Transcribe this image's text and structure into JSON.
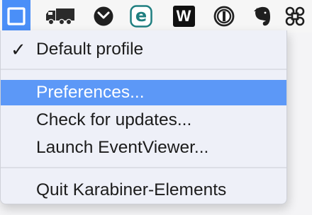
{
  "menubar": {
    "icons": [
      {
        "name": "karabiner-status-icon",
        "state": "active"
      },
      {
        "name": "truck-icon"
      },
      {
        "name": "chevron-circle-icon"
      },
      {
        "name": "eset-icon"
      },
      {
        "name": "word-counter-icon"
      },
      {
        "name": "onepassword-icon"
      },
      {
        "name": "evernote-icon"
      },
      {
        "name": "command-key-icon"
      }
    ],
    "eset_letter": "e",
    "w_letter": "W",
    "accent_color": "#4a8ff8"
  },
  "menu": {
    "profile_check": "✓",
    "profile_label": "Default profile",
    "preferences_label": "Preferences...",
    "check_updates_label": "Check for updates...",
    "launch_eventviewer_label": "Launch EventViewer...",
    "quit_label": "Quit Karabiner-Elements",
    "highlight_color": "#5c98f7"
  }
}
